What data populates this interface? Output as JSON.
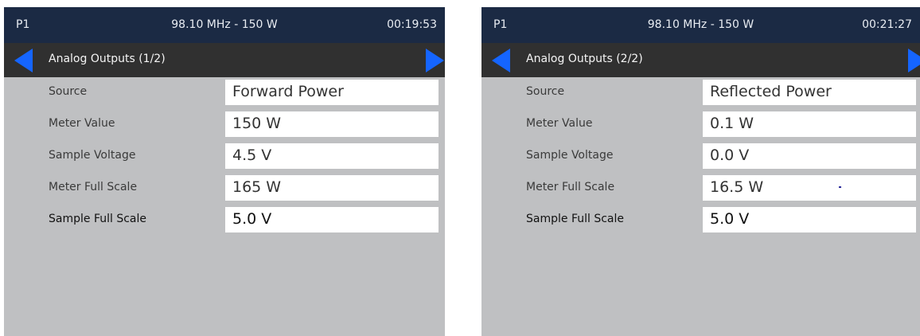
{
  "screens": [
    {
      "status": {
        "page": "P1",
        "freq_power": "98.10 MHz - 150 W",
        "time": "00:19:53"
      },
      "title": "Analog Outputs (1/2)",
      "rows": [
        {
          "label": "Source",
          "value": "Forward Power"
        },
        {
          "label": "Meter Value",
          "value": "150 W"
        },
        {
          "label": "Sample Voltage",
          "value": "4.5 V"
        },
        {
          "label": "Meter Full Scale",
          "value": "165 W"
        },
        {
          "label": "Sample Full Scale",
          "value": "5.0 V"
        }
      ]
    },
    {
      "status": {
        "page": "P1",
        "freq_power": "98.10 MHz - 150 W",
        "time": "00:21:27"
      },
      "title": "Analog Outputs (2/2)",
      "rows": [
        {
          "label": "Source",
          "value": "Reflected Power"
        },
        {
          "label": "Meter Value",
          "value": "0.1 W"
        },
        {
          "label": "Sample Voltage",
          "value": "0.0 V"
        },
        {
          "label": "Meter Full Scale",
          "value": "16.5 W"
        },
        {
          "label": "Sample Full Scale",
          "value": "5.0 V"
        }
      ]
    }
  ],
  "colors": {
    "status_bar": "#1b2a44",
    "nav_bar": "#303030",
    "panel_bg": "#bfc0c2",
    "arrow": "#1565ff",
    "field_bg": "#ffffff"
  },
  "icons": {
    "prev": "arrow-left-icon",
    "next": "arrow-right-icon"
  }
}
